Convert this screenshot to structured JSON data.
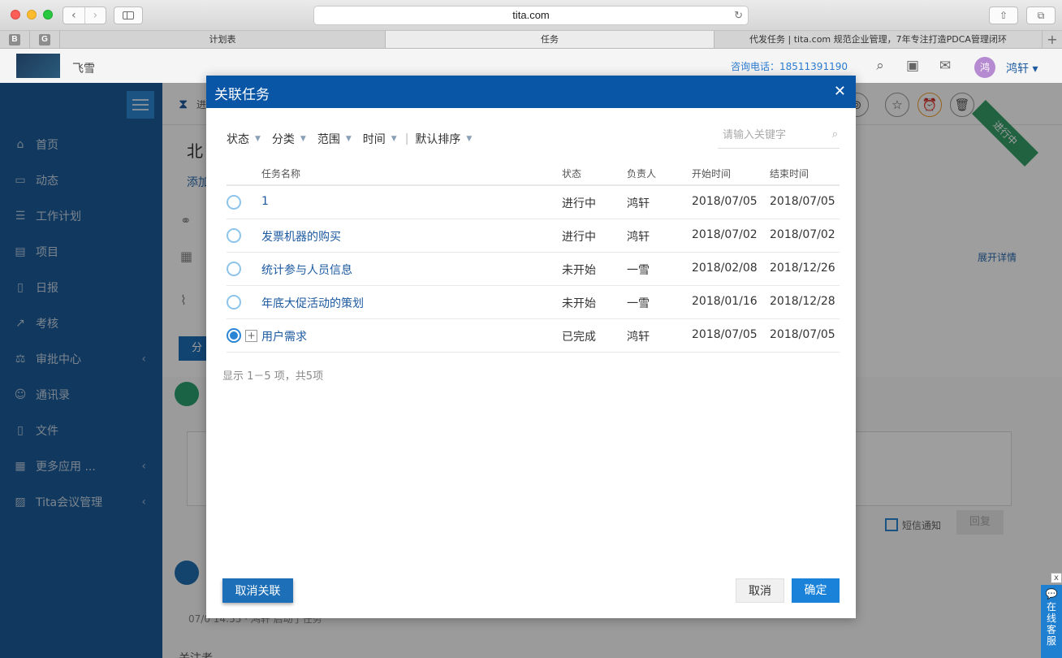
{
  "browser": {
    "url": "tita.com",
    "pinned_tabs": [
      "B",
      "G"
    ],
    "tabs": [
      {
        "label": "计划表"
      },
      {
        "label": "任务",
        "active": true
      },
      {
        "label": "代发任务 | tita.com 规范企业管理，7年专注打造PDCA管理闭环"
      }
    ]
  },
  "header": {
    "company": "飞雪",
    "phone": "咨询电话：18511391190",
    "avatar_text": "鸿",
    "user_name": "鸿轩 ▾"
  },
  "sidebar": {
    "items": [
      {
        "label": "首页",
        "icon": "home-icon",
        "glyph": "⌂"
      },
      {
        "label": "动态",
        "icon": "feed-icon",
        "glyph": "▭"
      },
      {
        "label": "工作计划",
        "icon": "list-icon",
        "glyph": "☰"
      },
      {
        "label": "项目",
        "icon": "project-icon",
        "glyph": "▤"
      },
      {
        "label": "日报",
        "icon": "report-icon",
        "glyph": "▯"
      },
      {
        "label": "考核",
        "icon": "assess-icon",
        "glyph": "↗"
      },
      {
        "label": "审批中心",
        "icon": "approval-icon",
        "glyph": "⚖",
        "arrow": "‹"
      },
      {
        "label": "通讯录",
        "icon": "contacts-icon",
        "glyph": "☺"
      },
      {
        "label": "文件",
        "icon": "file-icon",
        "glyph": "▯"
      },
      {
        "label": "更多应用 ...",
        "icon": "apps-icon",
        "glyph": "▦",
        "arrow": "‹"
      },
      {
        "label": "Tita会议管理",
        "icon": "meeting-icon",
        "glyph": "▨",
        "arrow": "‹"
      }
    ]
  },
  "background": {
    "title_partial": "北",
    "add_partial": "添加",
    "progress_partial": "进",
    "status_ribbon": "进行中",
    "expand_details": "展开详情",
    "assign_partial": "分解",
    "sms_label": "短信通知",
    "reply_label": "回复",
    "log_partial": "07/0  14:55  ·  鸿轩 启动了任务",
    "followers_partial": "关注者"
  },
  "service": {
    "text": "在线客服",
    "close": "x"
  },
  "modal": {
    "title": "关联任务",
    "close_glyph": "✕",
    "filters": [
      {
        "label": "状态"
      },
      {
        "label": "分类"
      },
      {
        "label": "范围"
      },
      {
        "label": "时间"
      },
      {
        "label": "默认排序"
      }
    ],
    "search_placeholder": "请输入关键字",
    "columns": {
      "name": "任务名称",
      "status": "状态",
      "owner": "负责人",
      "start": "开始时间",
      "end": "结束时间"
    },
    "rows": [
      {
        "name": "1",
        "status": "进行中",
        "owner": "鸿轩",
        "start": "2018/07/05",
        "end": "2018/07/05",
        "selected": false,
        "expandable": false
      },
      {
        "name": "发票机器的购买",
        "status": "进行中",
        "owner": "鸿轩",
        "start": "2018/07/02",
        "end": "2018/07/02",
        "selected": false,
        "expandable": false
      },
      {
        "name": "统计参与人员信息",
        "status": "未开始",
        "owner": "一雪",
        "start": "2018/02/08",
        "end": "2018/12/26",
        "selected": false,
        "expandable": false
      },
      {
        "name": "年底大促活动的策划",
        "status": "未开始",
        "owner": "一雪",
        "start": "2018/01/16",
        "end": "2018/12/28",
        "selected": false,
        "expandable": false
      },
      {
        "name": "用户需求",
        "status": "已完成",
        "owner": "鸿轩",
        "start": "2018/07/05",
        "end": "2018/07/05",
        "selected": true,
        "expandable": true
      }
    ],
    "pager": "显示 1－5 项，共5项",
    "unlink_label": "取消关联",
    "cancel_label": "取消",
    "ok_label": "确定"
  }
}
